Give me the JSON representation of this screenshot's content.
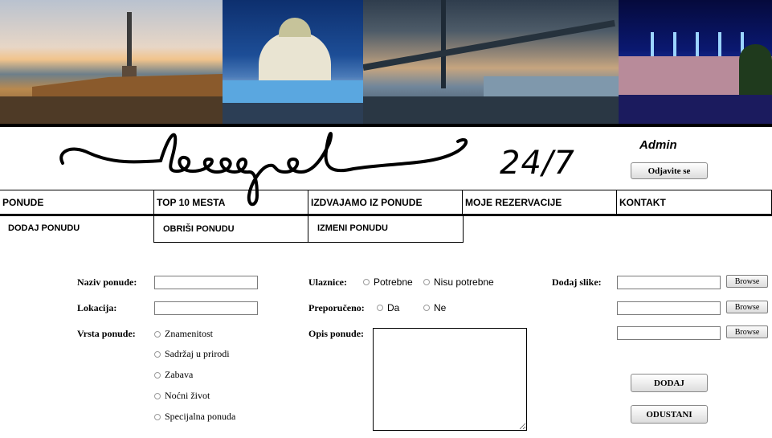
{
  "banner": {
    "photos": [
      "photo-kalemegdan",
      "photo-saint-sava",
      "photo-bridge",
      "photo-fortress-night"
    ]
  },
  "logo": {
    "number": "24/7"
  },
  "header": {
    "admin_label": "Admin",
    "logout_label": "Odjavite se"
  },
  "nav": {
    "items": [
      {
        "label": "PONUDE"
      },
      {
        "label": "TOP 10 MESTA"
      },
      {
        "label": "IZDVAJAMO IZ PONUDE"
      },
      {
        "label": "MOJE REZERVACIJE"
      },
      {
        "label": "KONTAKT"
      }
    ]
  },
  "subnav": {
    "items": [
      {
        "label": "DODAJ PONUDU"
      },
      {
        "label": "OBRIŠI PONUDU"
      },
      {
        "label": "IZMENI PONUDU"
      }
    ]
  },
  "form": {
    "name_label": "Naziv ponude:",
    "name_value": "",
    "location_label": "Lokacija:",
    "location_value": "",
    "type_label": "Vrsta ponude:",
    "type_options": [
      "Znamenitost",
      "Sadržaj u prirodi",
      "Zabava",
      "Noćni život",
      "Specijalna ponuda"
    ],
    "tickets_label": "Ulaznice:",
    "tickets_options": [
      "Potrebne",
      "Nisu potrebne"
    ],
    "recommended_label": "Preporučeno:",
    "recommended_options": [
      "Da",
      "Ne"
    ],
    "description_label": "Opis ponude:",
    "description_value": "",
    "images_label": "Dodaj slike:",
    "browse_label": "Browse",
    "add_label": "DODAJ",
    "cancel_label": "ODUSTANI"
  }
}
